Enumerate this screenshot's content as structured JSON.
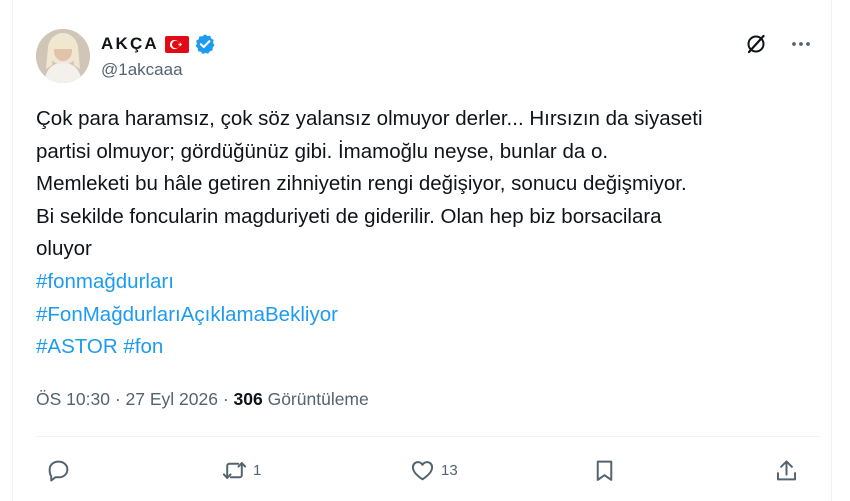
{
  "user": {
    "display_name": "AKÇA",
    "handle": "@1akcaaa",
    "verified": true,
    "flag": "turkey-flag"
  },
  "tweet": {
    "lines": [
      "Çok para haramsız, çok söz yalansız olmuyor derler... Hırsızın da siyaseti",
      "partisi olmuyor; gördüğünüz gibi. İmamoğlu neyse, bunlar da o.",
      "Memleketi bu hâle getiren zihniyetin rengi değişiyor, sonucu değişmiyor.",
      "Bi sekilde foncularin magduriyeti de giderilir. Olan hep biz borsacilara",
      "oluyor"
    ],
    "hashtag_lines": [
      "#fonmağdurları",
      "#FonMağdurlarıAçıklamaBekliyor",
      "#ASTOR #fon"
    ]
  },
  "meta": {
    "time": "ÖS 10:30",
    "sep1": " · ",
    "date": "27 Eyl 2026",
    "sep2": " · ",
    "views": "306",
    "views_label": " Görüntüleme"
  },
  "actions": {
    "reply_count": "",
    "retweet_count": "1",
    "like_count": "13"
  },
  "colors": {
    "accent": "#1d9bf0",
    "text": "#0f1419",
    "secondary": "#536471",
    "flag_red": "#e30a17"
  },
  "icons": [
    "grok-icon",
    "more-icon",
    "verified-icon",
    "reply-icon",
    "retweet-icon",
    "like-icon",
    "bookmark-icon",
    "share-icon"
  ]
}
